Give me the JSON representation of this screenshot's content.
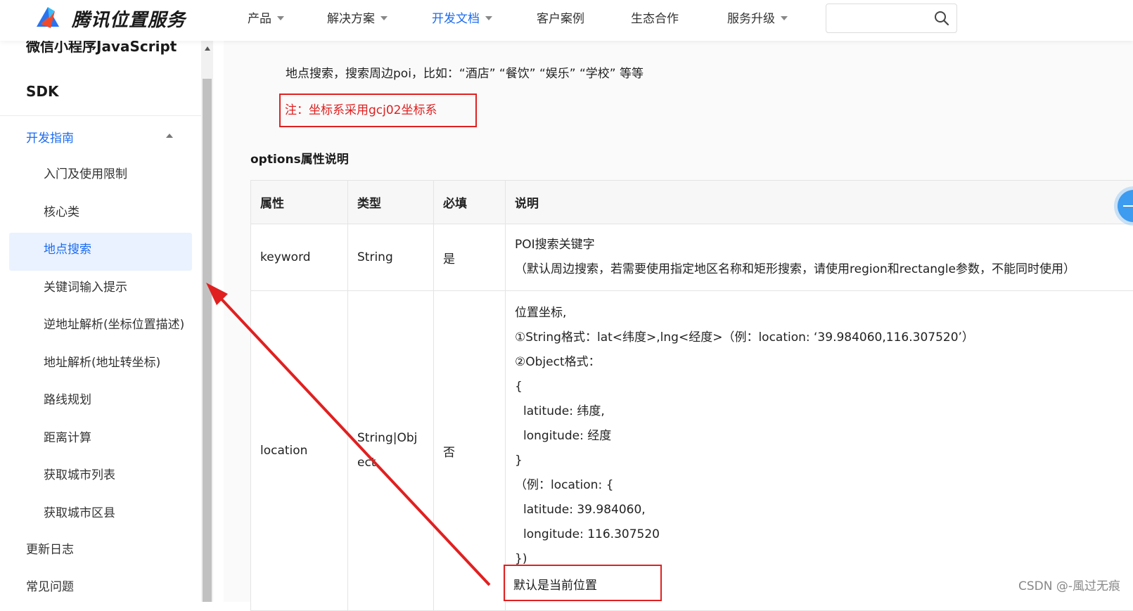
{
  "header": {
    "logo_text": "腾讯位置服务",
    "nav": [
      {
        "label": "产品",
        "has_caret": true
      },
      {
        "label": "解决方案",
        "has_caret": true
      },
      {
        "label": "开发文档",
        "has_caret": true,
        "active": true
      },
      {
        "label": "客户案例",
        "has_caret": false
      },
      {
        "label": "生态合作",
        "has_caret": false
      },
      {
        "label": "服务升级",
        "has_caret": true
      }
    ],
    "search": {
      "placeholder": "",
      "icon": "search-icon"
    }
  },
  "sidebar": {
    "title_line1": "微信小程序JavaScript",
    "title_line2": "SDK",
    "section": "开发指南",
    "items": [
      {
        "label": "入门及使用限制"
      },
      {
        "label": "核心类"
      },
      {
        "label": "地点搜索",
        "active": true
      },
      {
        "label": "关键词输入提示"
      },
      {
        "label": "逆地址解析(坐标位置描述)"
      },
      {
        "label": "地址解析(地址转坐标)"
      },
      {
        "label": "路线规划"
      },
      {
        "label": "距离计算"
      },
      {
        "label": "获取城市列表"
      },
      {
        "label": "获取城市区县"
      }
    ],
    "top_items": [
      {
        "label": "更新日志"
      },
      {
        "label": "常见问题"
      }
    ]
  },
  "main": {
    "intro": "地点搜索，搜索周边poi，比如：“酒店” “餐饮” “娱乐” “学校” 等等",
    "note": "注：坐标系采用gcj02坐标系",
    "options_heading": "options属性说明",
    "table": {
      "headers": [
        "属性",
        "类型",
        "必填",
        "说明"
      ],
      "rows": [
        {
          "name": "keyword",
          "type": "String",
          "required": "是",
          "desc": [
            "POI搜索关键字",
            "（默认周边搜索，若需要使用指定地区名称和矩形搜索，请使用region和rectangle参数，不能同时使用）"
          ]
        },
        {
          "name": "location",
          "type": "String|Object",
          "required": "否",
          "desc": [
            "位置坐标,",
            "①String格式：lat<纬度>,lng<经度>（例：location: ‘39.984060,116.307520’）",
            "②Object格式：",
            "{",
            "  latitude: 纬度,",
            "  longitude: 经度",
            "}",
            "（例：location: {",
            "  latitude: 39.984060,",
            "  longitude: 116.307520",
            "})",
            "默认是当前位置"
          ]
        }
      ]
    }
  },
  "watermark": "CSDN @-風过无痕",
  "colors": {
    "accent": "#1c6cf0",
    "annotation": "#e02020"
  }
}
